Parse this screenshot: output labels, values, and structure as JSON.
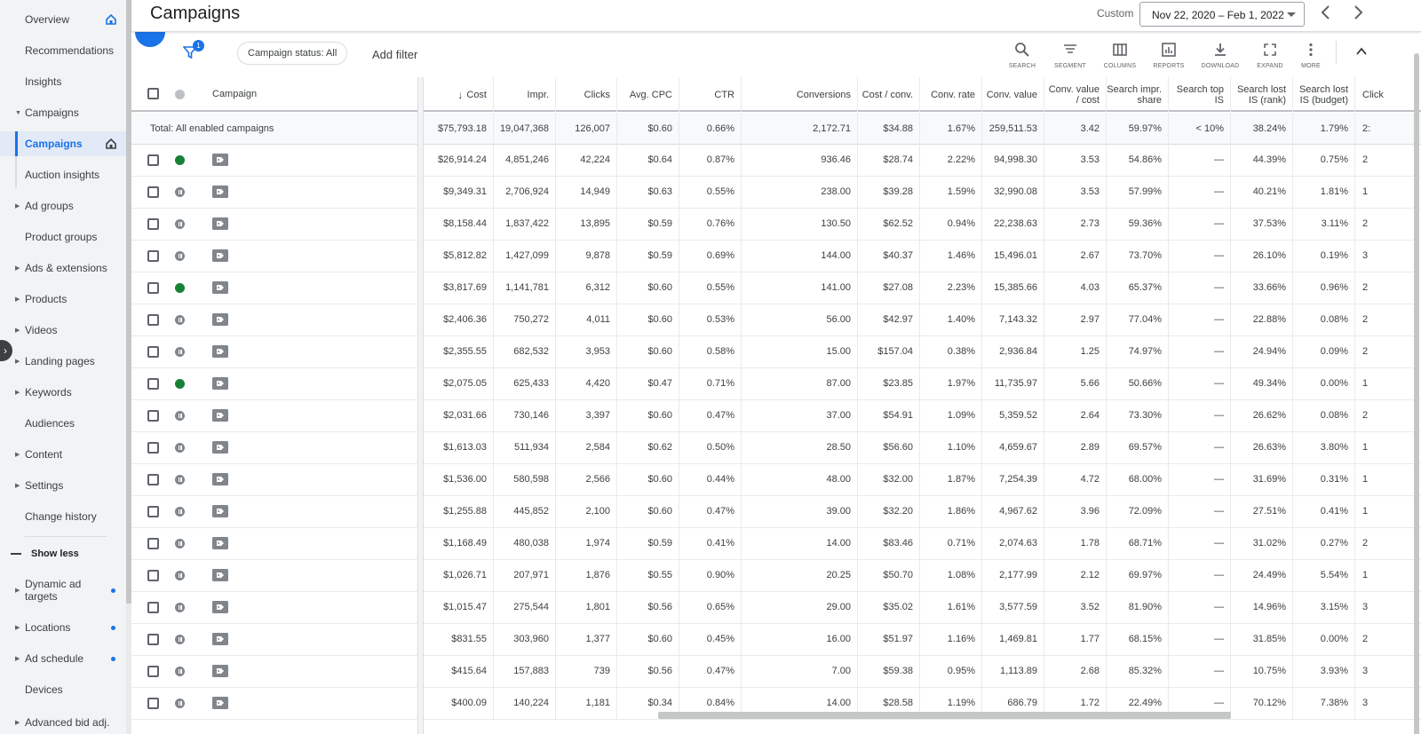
{
  "sidebar": {
    "items": [
      {
        "label": "Overview",
        "top": 0
      },
      {
        "label": "Recommendations"
      },
      {
        "label": "Insights"
      },
      {
        "label": "Campaigns"
      },
      {
        "label": "Campaigns"
      },
      {
        "label": "Auction insights"
      },
      {
        "label": "Ad groups"
      },
      {
        "label": "Product groups"
      },
      {
        "label": "Ads & extensions"
      },
      {
        "label": "Products"
      },
      {
        "label": "Videos"
      },
      {
        "label": "Landing pages"
      },
      {
        "label": "Keywords"
      },
      {
        "label": "Audiences"
      },
      {
        "label": "Content"
      },
      {
        "label": "Settings"
      },
      {
        "label": "Change history"
      },
      {
        "label": "Show less"
      },
      {
        "label": "Dynamic ad targets"
      },
      {
        "label": "Locations"
      },
      {
        "label": "Ad schedule"
      },
      {
        "label": "Devices"
      },
      {
        "label": "Advanced bid adj."
      }
    ],
    "accent_color": "#1a73e8"
  },
  "header": {
    "title": "Campaigns",
    "custom_label": "Custom",
    "date_range": "Nov 22, 2020 – Feb 1, 2022"
  },
  "toolbar": {
    "filter_count": "1",
    "status_chip": "Campaign status: All",
    "add_filter": "Add filter",
    "tools": [
      "SEARCH",
      "SEGMENT",
      "COLUMNS",
      "REPORTS",
      "DOWNLOAD",
      "EXPAND",
      "MORE"
    ]
  },
  "table": {
    "campaign_header": "Campaign",
    "columns": [
      "Cost",
      "Impr.",
      "Clicks",
      "Avg. CPC",
      "CTR",
      "Conversions",
      "Cost / conv.",
      "Conv. rate",
      "Conv. value",
      "Conv. value / cost",
      "Search impr. share",
      "Search top IS",
      "Search lost IS (rank)",
      "Search lost IS (budget)",
      "Click"
    ],
    "total_label": "Total: All enabled campaigns",
    "total": [
      "$75,793.18",
      "19,047,368",
      "126,007",
      "$0.60",
      "0.66%",
      "2,172.71",
      "$34.88",
      "1.67%",
      "259,511.53",
      "3.42",
      "59.97%",
      "< 10%",
      "38.24%",
      "1.79%",
      "2:"
    ],
    "rows": [
      {
        "status": "enabled",
        "cells": [
          "$26,914.24",
          "4,851,246",
          "42,224",
          "$0.64",
          "0.87%",
          "936.46",
          "$28.74",
          "2.22%",
          "94,998.30",
          "3.53",
          "54.86%",
          "—",
          "44.39%",
          "0.75%",
          "2"
        ]
      },
      {
        "status": "paused",
        "cells": [
          "$9,349.31",
          "2,706,924",
          "14,949",
          "$0.63",
          "0.55%",
          "238.00",
          "$39.28",
          "1.59%",
          "32,990.08",
          "3.53",
          "57.99%",
          "—",
          "40.21%",
          "1.81%",
          "1"
        ]
      },
      {
        "status": "paused",
        "cells": [
          "$8,158.44",
          "1,837,422",
          "13,895",
          "$0.59",
          "0.76%",
          "130.50",
          "$62.52",
          "0.94%",
          "22,238.63",
          "2.73",
          "59.36%",
          "—",
          "37.53%",
          "3.11%",
          "2"
        ]
      },
      {
        "status": "paused",
        "cells": [
          "$5,812.82",
          "1,427,099",
          "9,878",
          "$0.59",
          "0.69%",
          "144.00",
          "$40.37",
          "1.46%",
          "15,496.01",
          "2.67",
          "73.70%",
          "—",
          "26.10%",
          "0.19%",
          "3"
        ]
      },
      {
        "status": "enabled",
        "cells": [
          "$3,817.69",
          "1,141,781",
          "6,312",
          "$0.60",
          "0.55%",
          "141.00",
          "$27.08",
          "2.23%",
          "15,385.66",
          "4.03",
          "65.37%",
          "—",
          "33.66%",
          "0.96%",
          "2"
        ]
      },
      {
        "status": "paused",
        "cells": [
          "$2,406.36",
          "750,272",
          "4,011",
          "$0.60",
          "0.53%",
          "56.00",
          "$42.97",
          "1.40%",
          "7,143.32",
          "2.97",
          "77.04%",
          "—",
          "22.88%",
          "0.08%",
          "2"
        ]
      },
      {
        "status": "paused",
        "cells": [
          "$2,355.55",
          "682,532",
          "3,953",
          "$0.60",
          "0.58%",
          "15.00",
          "$157.04",
          "0.38%",
          "2,936.84",
          "1.25",
          "74.97%",
          "—",
          "24.94%",
          "0.09%",
          "2"
        ]
      },
      {
        "status": "enabled",
        "cells": [
          "$2,075.05",
          "625,433",
          "4,420",
          "$0.47",
          "0.71%",
          "87.00",
          "$23.85",
          "1.97%",
          "11,735.97",
          "5.66",
          "50.66%",
          "—",
          "49.34%",
          "0.00%",
          "1"
        ]
      },
      {
        "status": "paused",
        "cells": [
          "$2,031.66",
          "730,146",
          "3,397",
          "$0.60",
          "0.47%",
          "37.00",
          "$54.91",
          "1.09%",
          "5,359.52",
          "2.64",
          "73.30%",
          "—",
          "26.62%",
          "0.08%",
          "2"
        ]
      },
      {
        "status": "paused",
        "cells": [
          "$1,613.03",
          "511,934",
          "2,584",
          "$0.62",
          "0.50%",
          "28.50",
          "$56.60",
          "1.10%",
          "4,659.67",
          "2.89",
          "69.57%",
          "—",
          "26.63%",
          "3.80%",
          "1"
        ]
      },
      {
        "status": "paused",
        "cells": [
          "$1,536.00",
          "580,598",
          "2,566",
          "$0.60",
          "0.44%",
          "48.00",
          "$32.00",
          "1.87%",
          "7,254.39",
          "4.72",
          "68.00%",
          "—",
          "31.69%",
          "0.31%",
          "1"
        ]
      },
      {
        "status": "paused",
        "cells": [
          "$1,255.88",
          "445,852",
          "2,100",
          "$0.60",
          "0.47%",
          "39.00",
          "$32.20",
          "1.86%",
          "4,967.62",
          "3.96",
          "72.09%",
          "—",
          "27.51%",
          "0.41%",
          "1"
        ]
      },
      {
        "status": "paused",
        "cells": [
          "$1,168.49",
          "480,038",
          "1,974",
          "$0.59",
          "0.41%",
          "14.00",
          "$83.46",
          "0.71%",
          "2,074.63",
          "1.78",
          "68.71%",
          "—",
          "31.02%",
          "0.27%",
          "2"
        ]
      },
      {
        "status": "paused",
        "cells": [
          "$1,026.71",
          "207,971",
          "1,876",
          "$0.55",
          "0.90%",
          "20.25",
          "$50.70",
          "1.08%",
          "2,177.99",
          "2.12",
          "69.97%",
          "—",
          "24.49%",
          "5.54%",
          "1"
        ]
      },
      {
        "status": "paused",
        "cells": [
          "$1,015.47",
          "275,544",
          "1,801",
          "$0.56",
          "0.65%",
          "29.00",
          "$35.02",
          "1.61%",
          "3,577.59",
          "3.52",
          "81.90%",
          "—",
          "14.96%",
          "3.15%",
          "3"
        ]
      },
      {
        "status": "paused",
        "cells": [
          "$831.55",
          "303,960",
          "1,377",
          "$0.60",
          "0.45%",
          "16.00",
          "$51.97",
          "1.16%",
          "1,469.81",
          "1.77",
          "68.15%",
          "—",
          "31.85%",
          "0.00%",
          "2"
        ]
      },
      {
        "status": "paused",
        "cells": [
          "$415.64",
          "157,883",
          "739",
          "$0.56",
          "0.47%",
          "7.00",
          "$59.38",
          "0.95%",
          "1,113.89",
          "2.68",
          "85.32%",
          "—",
          "10.75%",
          "3.93%",
          "3"
        ]
      },
      {
        "status": "paused",
        "cells": [
          "$400.09",
          "140,224",
          "1,181",
          "$0.34",
          "0.84%",
          "14.00",
          "$28.58",
          "1.19%",
          "686.79",
          "1.72",
          "22.49%",
          "—",
          "70.12%",
          "7.38%",
          "3"
        ]
      }
    ]
  }
}
